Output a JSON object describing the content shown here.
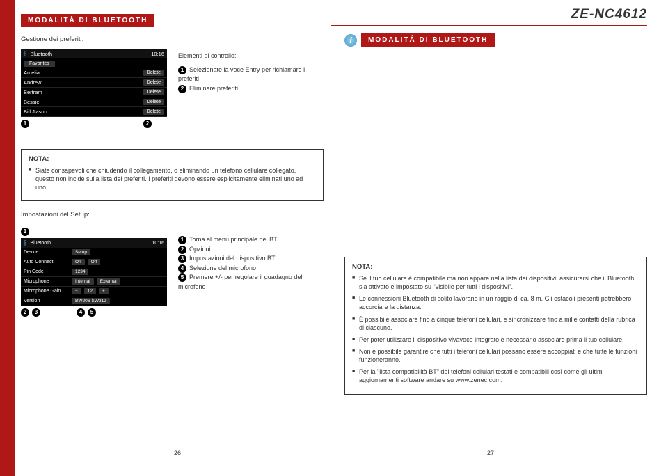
{
  "model": "ZE-NC4612",
  "left": {
    "section_title": "MODALITÀ DI BLUETOOTH",
    "subhead": "Gestione dei preferiti:",
    "fav_screen": {
      "title": "Bluetooth",
      "time": "10:16",
      "tab": "Favorites",
      "rows": [
        {
          "name": "Amelia",
          "btn": "Delete"
        },
        {
          "name": "Andrew",
          "btn": "Delete"
        },
        {
          "name": "Bertram",
          "btn": "Delete"
        },
        {
          "name": "Bessie",
          "btn": "Delete"
        },
        {
          "name": "Bill Jiason",
          "btn": "Delete"
        }
      ],
      "marker1": "1",
      "marker2": "2"
    },
    "controls_head": "Elementi di controllo:",
    "controls": [
      {
        "n": "1",
        "t": "Selezionate la voce Entry per richiamare i preferiti"
      },
      {
        "n": "2",
        "t": "Eliminare preferiti"
      }
    ],
    "note": {
      "title": "NOTA:",
      "items": [
        "Siate consapevoli che chiudendo il collegamento, o eliminando un telefono cellulare collegato, questo non incide sulla lista dei preferiti. I preferiti devono essere esplicitamente eliminati uno ad uno."
      ]
    },
    "setup_head": "Impostazioni del Setup:",
    "setup_screen": {
      "title": "Bluetooth",
      "time": "10:16",
      "tab": "Setup",
      "rows": [
        {
          "l": "Device",
          "v": "Setup"
        },
        {
          "l": "Auto Connect",
          "v1": "On",
          "v2": "Off"
        },
        {
          "l": "Pin Code",
          "v": "1234"
        },
        {
          "l": "Microphone",
          "v1": "Internal",
          "v2": "External"
        },
        {
          "l": "Microphone Gain",
          "v1": "−",
          "v2": "12",
          "v3": "+"
        },
        {
          "l": "Version",
          "v": "BW206-SW312"
        }
      ]
    },
    "setup_markers": {
      "m1": "1",
      "m2": "2",
      "m3": "3",
      "m4": "4",
      "m5": "5"
    },
    "setup_ctrl": [
      {
        "n": "1",
        "t": "Torna al menu principale del BT"
      },
      {
        "n": "2",
        "t": "Opzioni"
      },
      {
        "n": "3",
        "t": "Impostazioni del dispositivo BT"
      },
      {
        "n": "4",
        "t": "Selezione del microfono"
      },
      {
        "n": "5",
        "t": "Premere +/- per regolare il guadagno del microfono"
      }
    ],
    "pagenum": "26"
  },
  "right": {
    "section_title": "MODALITÁ DI BLUETOOTH",
    "info": "i",
    "note": {
      "title": "NOTA:",
      "items": [
        "Se il tuo cellulare è compatibile ma non appare nella lista dei dispositivi, assicurarsi che il Bluetooth sia attivato e impostato su \"visibile per tutti i dispositivi\".",
        "Le connessioni Bluetooth di solito lavorano in un raggio di ca. 8 m. Gli ostacoli presenti potrebbero accorciare la distanza.",
        "È possibile associare fino a cinque telefoni cellulari, e sincronizzare fino a mille contatti della rubrica di ciascuno.",
        "Per poter utilizzare il dispositivo vivavoce integrato è necessario associare prima il tuo cellulare.",
        "Non è possibile garantire che tutti i telefoni cellulari possano essere accoppiati e che tutte le funzioni funzioneranno.",
        "Per la \"lista compatibilità BT\" dei telefoni cellulari testati e compatibili così come gli ultimi aggiornamenti software andare su www.zenec.com."
      ]
    },
    "pagenum": "27"
  }
}
